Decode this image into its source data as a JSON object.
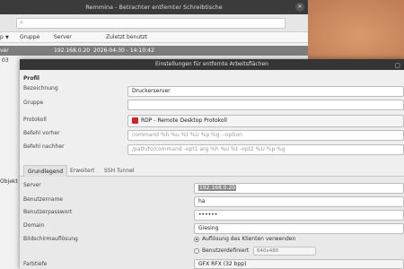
{
  "main_window": {
    "title": "Remmina - Betrachter entfernter Schreibtische",
    "columns": [
      "p",
      "Gruppe",
      "Server",
      "Zuletzt benutzt"
    ],
    "selected_row": {
      "name": "ver",
      "server": "192.168.0.20",
      "last_used": "2026-04-30 - 14:10:42"
    },
    "side_items": [
      "03",
      "Objekt"
    ]
  },
  "dialog": {
    "title": "Einstellungen für entfernte Arbeitsflächen",
    "section_profile": "Profil",
    "labels": {
      "name": "Bezeichnung",
      "group": "Gruppe",
      "protocol": "Protokoll",
      "pre_command": "Befehl vorher",
      "post_command": "Befehl nachher"
    },
    "values": {
      "name": "Druckerserver",
      "group": "",
      "protocol": "RDP - Remote Desktop Protokoll"
    },
    "placeholders": {
      "pre_command": "command %h %u %t %U %p %g --option",
      "post_command": "/path/to/command -opt1 arg %h %u %t -opt2 %U %p %g"
    },
    "tabs": [
      "Grundlegend",
      "Erweitert",
      "SSH Tunnel"
    ],
    "active_tab": 0,
    "basic": {
      "labels": {
        "server": "Server",
        "username": "Benutzername",
        "password": "Benutzerpasswort",
        "domain": "Domain",
        "resolution": "Bildschirmauflösung",
        "color_depth": "Farbtiefe"
      },
      "values": {
        "server": "192.168.0.20",
        "username": "ha",
        "password": "••••••",
        "domain": "Giesing",
        "color_depth": "GFX RFX (32 bpp)"
      },
      "resolution_options": {
        "client": "Auflösung des Klienten verwenden",
        "custom": "Benutzerdefiniert",
        "custom_value": "640x480"
      }
    }
  }
}
